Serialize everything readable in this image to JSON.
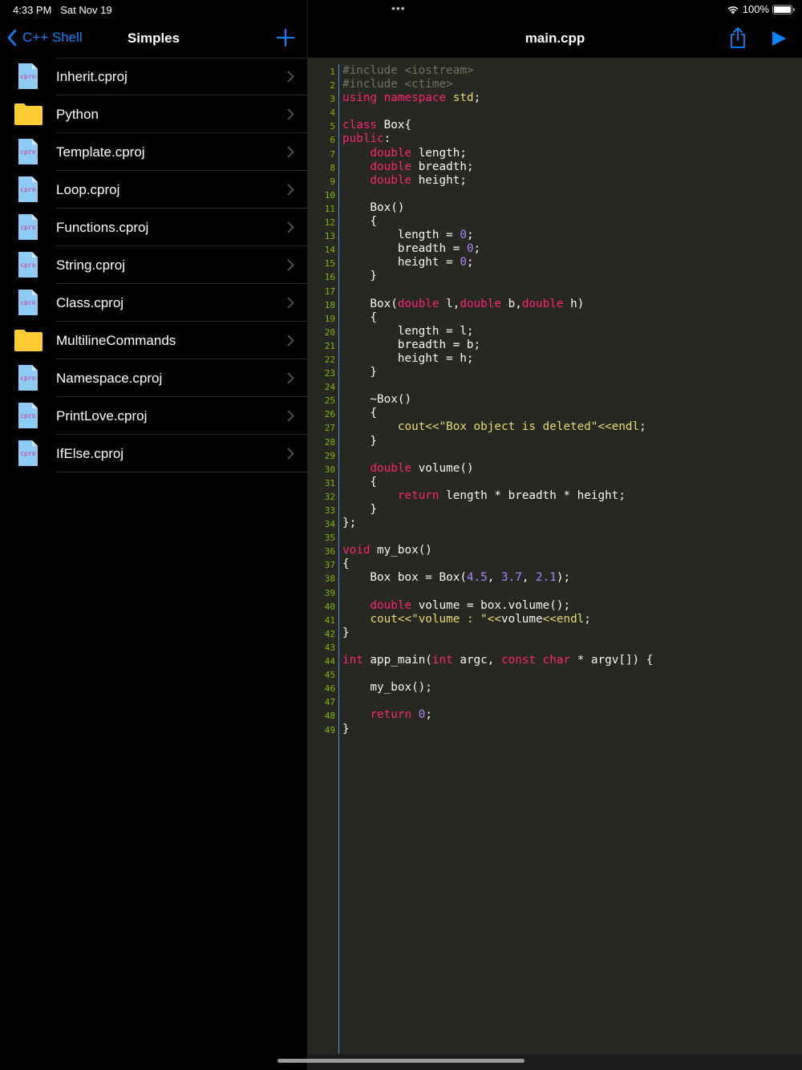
{
  "status": {
    "time": "4:33 PM",
    "date": "Sat Nov 19",
    "battery": "100%"
  },
  "sidebar": {
    "back_label": "C++ Shell",
    "title": "Simples",
    "items": [
      {
        "name": "Inherit.cproj",
        "type": "cproj"
      },
      {
        "name": "Python",
        "type": "folder"
      },
      {
        "name": "Template.cproj",
        "type": "cproj"
      },
      {
        "name": "Loop.cproj",
        "type": "cproj"
      },
      {
        "name": "Functions.cproj",
        "type": "cproj"
      },
      {
        "name": "String.cproj",
        "type": "cproj"
      },
      {
        "name": "Class.cproj",
        "type": "cproj"
      },
      {
        "name": "MultilineCommands",
        "type": "folder"
      },
      {
        "name": "Namespace.cproj",
        "type": "cproj"
      },
      {
        "name": "PrintLove.cproj",
        "type": "cproj"
      },
      {
        "name": "IfElse.cproj",
        "type": "cproj"
      }
    ],
    "file_icon_label": "cpro"
  },
  "editor": {
    "title": "main.cpp",
    "code": [
      [
        [
          "c",
          "#include <iostream>"
        ]
      ],
      [
        [
          "c",
          "#include <ctime>"
        ]
      ],
      [
        [
          "k",
          "using"
        ],
        [
          "p",
          " "
        ],
        [
          "k",
          "namespace"
        ],
        [
          "p",
          " "
        ],
        [
          "s",
          "std"
        ],
        [
          "p",
          ";"
        ]
      ],
      [],
      [
        [
          "k",
          "class"
        ],
        [
          "p",
          " Box{"
        ]
      ],
      [
        [
          "k",
          "public"
        ],
        [
          "p",
          ":"
        ]
      ],
      [
        [
          "p",
          "    "
        ],
        [
          "k",
          "double"
        ],
        [
          "p",
          " length;"
        ]
      ],
      [
        [
          "p",
          "    "
        ],
        [
          "k",
          "double"
        ],
        [
          "p",
          " breadth;"
        ]
      ],
      [
        [
          "p",
          "    "
        ],
        [
          "k",
          "double"
        ],
        [
          "p",
          " height;"
        ]
      ],
      [],
      [
        [
          "p",
          "    Box()"
        ]
      ],
      [
        [
          "p",
          "    {"
        ]
      ],
      [
        [
          "p",
          "        length = "
        ],
        [
          "n",
          "0"
        ],
        [
          "p",
          ";"
        ]
      ],
      [
        [
          "p",
          "        breadth = "
        ],
        [
          "n",
          "0"
        ],
        [
          "p",
          ";"
        ]
      ],
      [
        [
          "p",
          "        height = "
        ],
        [
          "n",
          "0"
        ],
        [
          "p",
          ";"
        ]
      ],
      [
        [
          "p",
          "    }"
        ]
      ],
      [],
      [
        [
          "p",
          "    Box("
        ],
        [
          "k",
          "double"
        ],
        [
          "p",
          " l,"
        ],
        [
          "k",
          "double"
        ],
        [
          "p",
          " b,"
        ],
        [
          "k",
          "double"
        ],
        [
          "p",
          " h)"
        ]
      ],
      [
        [
          "p",
          "    {"
        ]
      ],
      [
        [
          "p",
          "        length = l;"
        ]
      ],
      [
        [
          "p",
          "        breadth = b;"
        ]
      ],
      [
        [
          "p",
          "        height = h;"
        ]
      ],
      [
        [
          "p",
          "    }"
        ]
      ],
      [],
      [
        [
          "p",
          "    ~Box()"
        ]
      ],
      [
        [
          "p",
          "    {"
        ]
      ],
      [
        [
          "p",
          "        "
        ],
        [
          "s",
          "cout<<\"Box object is deleted\"<<endl"
        ],
        [
          "p",
          ";"
        ]
      ],
      [
        [
          "p",
          "    }"
        ]
      ],
      [],
      [
        [
          "p",
          "    "
        ],
        [
          "k",
          "double"
        ],
        [
          "p",
          " volume()"
        ]
      ],
      [
        [
          "p",
          "    {"
        ]
      ],
      [
        [
          "p",
          "        "
        ],
        [
          "k",
          "return"
        ],
        [
          "p",
          " length * breadth * height;"
        ]
      ],
      [
        [
          "p",
          "    }"
        ]
      ],
      [
        [
          "p",
          "};"
        ]
      ],
      [],
      [
        [
          "k",
          "void"
        ],
        [
          "p",
          " my_box()"
        ]
      ],
      [
        [
          "p",
          "{"
        ]
      ],
      [
        [
          "p",
          "    Box box = Box("
        ],
        [
          "n",
          "4.5"
        ],
        [
          "p",
          ", "
        ],
        [
          "n",
          "3.7"
        ],
        [
          "p",
          ", "
        ],
        [
          "n",
          "2.1"
        ],
        [
          "p",
          ");"
        ]
      ],
      [],
      [
        [
          "p",
          "    "
        ],
        [
          "k",
          "double"
        ],
        [
          "p",
          " volume = box.volume();"
        ]
      ],
      [
        [
          "p",
          "    "
        ],
        [
          "s",
          "cout<<\"volume : \"<<"
        ],
        [
          "p",
          "volume"
        ],
        [
          "s",
          "<<endl"
        ],
        [
          "p",
          ";"
        ]
      ],
      [
        [
          "p",
          "}"
        ]
      ],
      [],
      [
        [
          "k",
          "int"
        ],
        [
          "p",
          " app_main("
        ],
        [
          "k",
          "int"
        ],
        [
          "p",
          " argc, "
        ],
        [
          "k",
          "const"
        ],
        [
          "p",
          " "
        ],
        [
          "k",
          "char"
        ],
        [
          "p",
          " * argv[]) {"
        ]
      ],
      [],
      [
        [
          "p",
          "    my_box();"
        ]
      ],
      [],
      [
        [
          "p",
          "    "
        ],
        [
          "k",
          "return"
        ],
        [
          "p",
          " "
        ],
        [
          "n",
          "0"
        ],
        [
          "p",
          ";"
        ]
      ],
      [
        [
          "p",
          "}"
        ]
      ]
    ]
  },
  "colors": {
    "accent": "#0a84ff",
    "editor_bg": "#272822",
    "keyword": "#f92672",
    "string": "#e6db74",
    "number": "#ae81ff",
    "comment": "#75715e",
    "line_number": "#7fb800",
    "folder": "#ffcc33",
    "file_icon": "#8ecbf5"
  }
}
